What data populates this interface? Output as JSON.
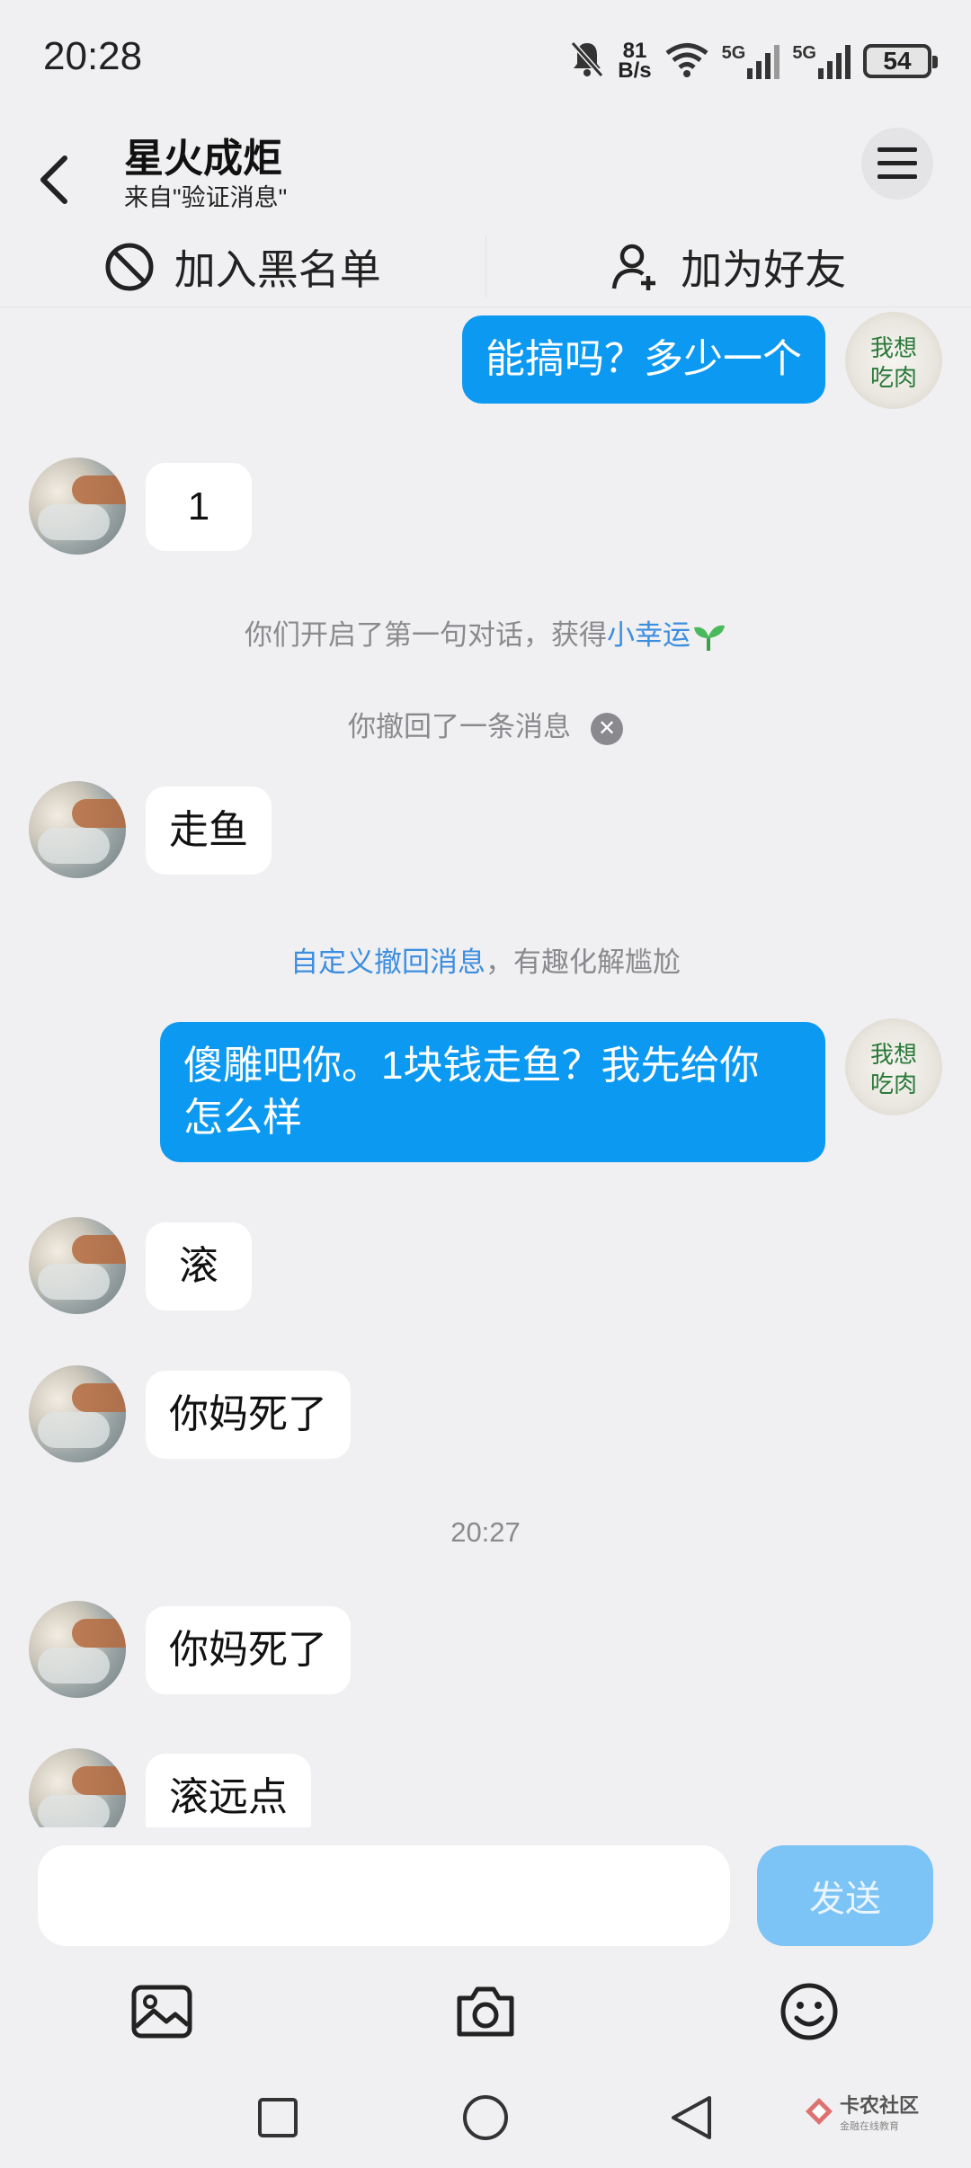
{
  "status_bar": {
    "time": "20:28",
    "net_speed_value": "81",
    "net_speed_unit": "B/s",
    "sim1_label": "5G",
    "sim2_label": "5G",
    "battery": "54"
  },
  "header": {
    "title": "星火成炬",
    "subtitle": "来自\"验证消息\""
  },
  "actions": {
    "blacklist": "加入黑名单",
    "add_friend": "加为好友"
  },
  "messages": [
    {
      "side": "self",
      "text": "能搞吗？多少一个"
    },
    {
      "side": "other",
      "text": "1"
    },
    {
      "type": "system",
      "prefix": "你们开启了第一句对话，获得",
      "link": "小幸运"
    },
    {
      "type": "system",
      "text": "你撤回了一条消息"
    },
    {
      "side": "other",
      "text": "走鱼"
    },
    {
      "type": "system",
      "link": "自定义撤回消息",
      "suffix": "，有趣化解尴尬"
    },
    {
      "side": "self",
      "line1": "傻雕吧你。1块钱走鱼？我先给你",
      "line2": "怎么样"
    },
    {
      "side": "other",
      "text": "滚"
    },
    {
      "side": "other",
      "text": "你妈死了"
    },
    {
      "type": "timestamp",
      "text": "20:27"
    },
    {
      "side": "other",
      "text": "你妈死了"
    },
    {
      "side": "other",
      "text": "滚远点"
    }
  ],
  "self_avatar_text": "我想吃肉",
  "composer": {
    "placeholder": "",
    "send_label": "发送"
  },
  "watermark": {
    "main": "卡农社区",
    "sub": "金融在线教育"
  },
  "colors": {
    "self_bubble": "#0c99f2",
    "link": "#3c8ee0",
    "send_disabled": "#7cc3f6"
  }
}
